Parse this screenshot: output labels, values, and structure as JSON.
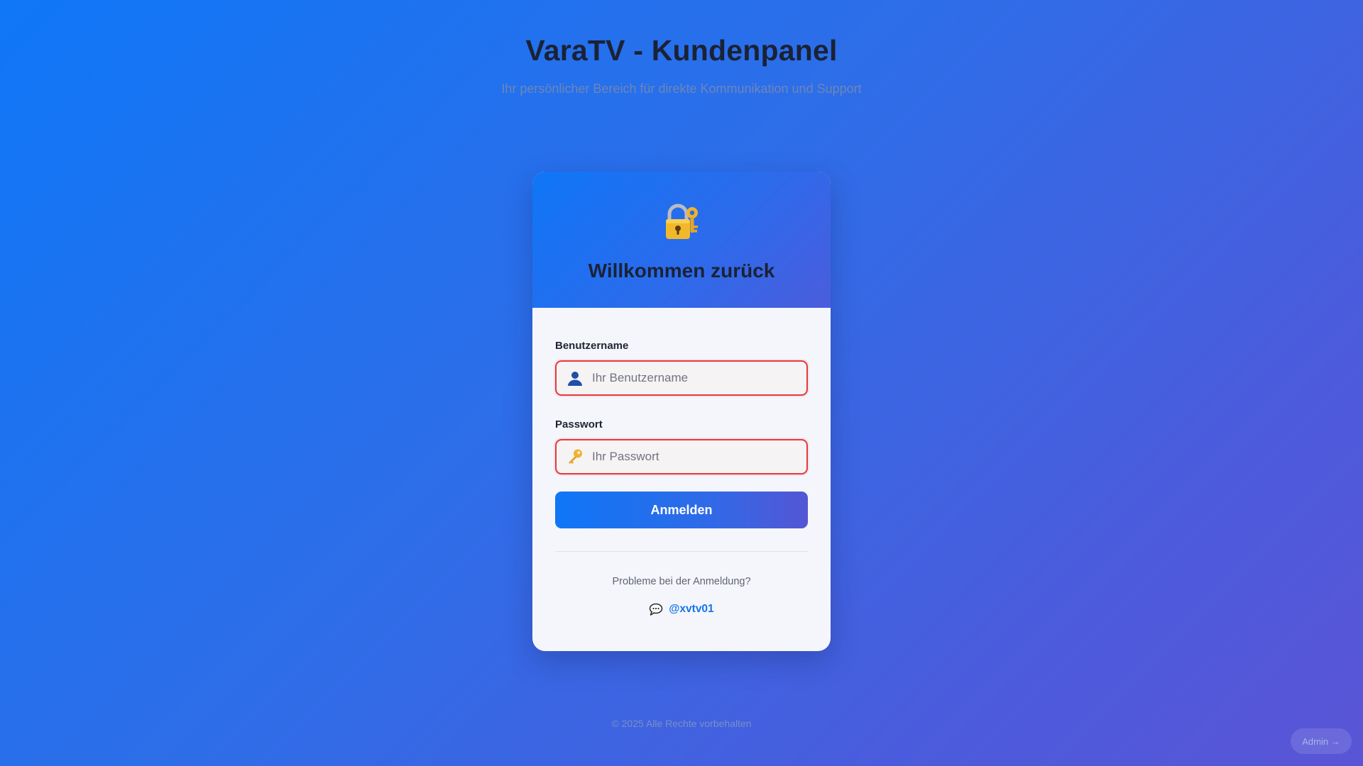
{
  "header": {
    "title": "VaraTV - Kundenpanel",
    "subtitle": "Ihr persönlicher Bereich für direkte Kommunikation und Support"
  },
  "login_card": {
    "icon": "lock-with-key-icon",
    "title": "Willkommen zurück",
    "username": {
      "label": "Benutzername",
      "placeholder": "Ihr Benutzername",
      "value": "",
      "icon": "user-icon"
    },
    "password": {
      "label": "Passwort",
      "placeholder": "Ihr Passwort",
      "value": "",
      "icon": "key-icon"
    },
    "submit_label": "Anmelden",
    "help_text": "Probleme bei der Anmeldung?",
    "contact": {
      "icon": "speech-bubble-icon",
      "handle": "@xvtv01"
    }
  },
  "footer": {
    "copyright": "© 2025 Alle Rechte vorbehalten"
  },
  "admin_link": {
    "label": "Admin →"
  },
  "colors": {
    "accent": "#0f76f6",
    "accent_end": "#5456d4",
    "error_border": "#e5393d",
    "link": "#1576e8"
  }
}
